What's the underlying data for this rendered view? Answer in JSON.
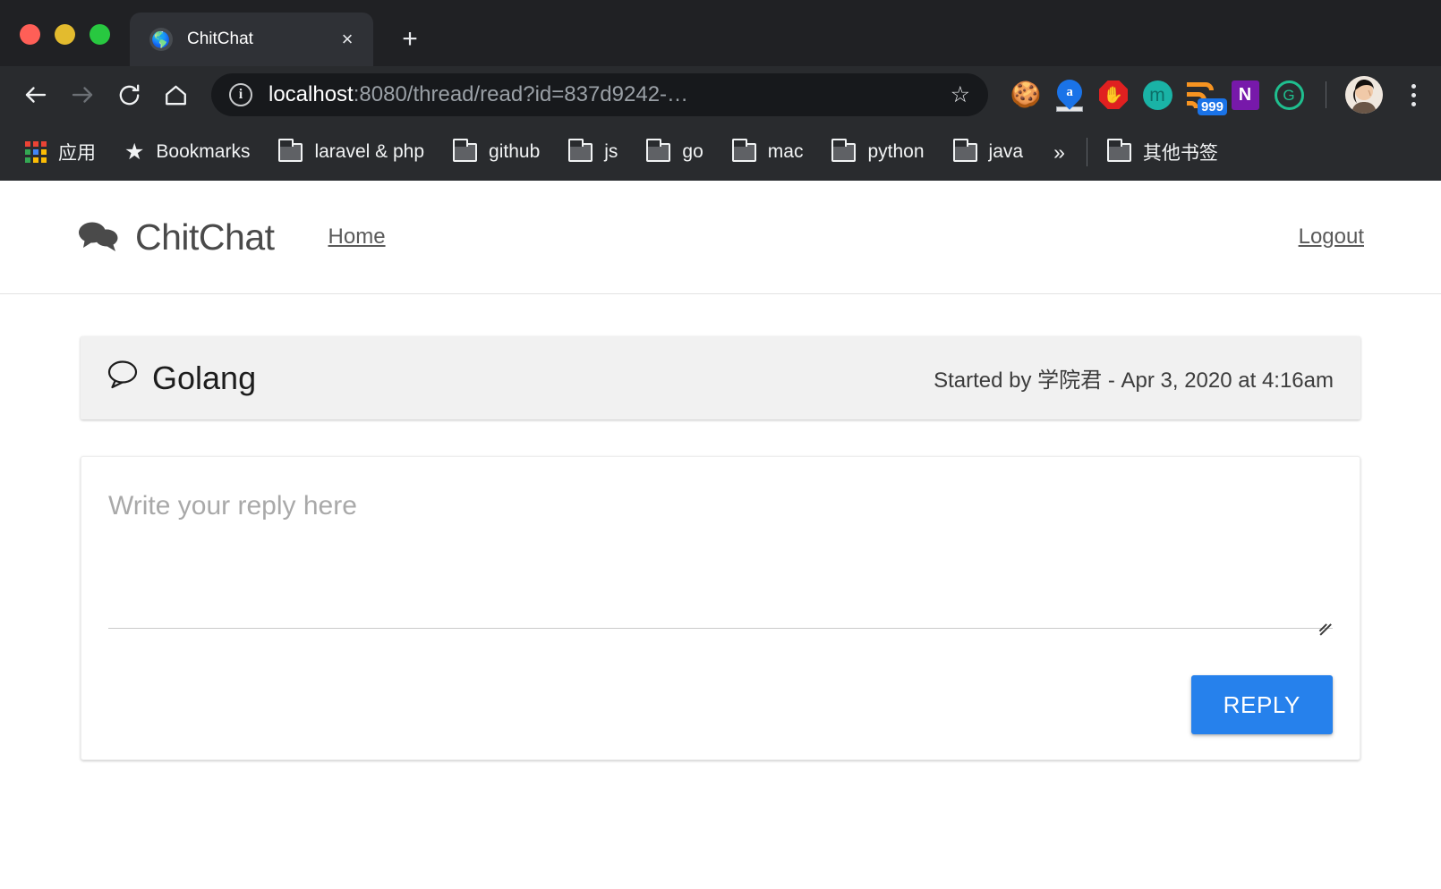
{
  "browser": {
    "window_controls": [
      "close",
      "minimize",
      "maximize"
    ],
    "tab": {
      "title": "ChitChat",
      "favicon": "globe-icon",
      "close_label": "×"
    },
    "new_tab_label": "+",
    "nav": {
      "back": "←",
      "forward": "→",
      "reload": "⟳",
      "home": "⌂"
    },
    "omnibox": {
      "info_icon": "i",
      "url_host": "localhost",
      "url_rest": ":8080/thread/read?id=837d9242-…",
      "bookmark_star": "☆"
    },
    "extensions": [
      {
        "name": "cookie-extension-icon",
        "glyph": "🍪"
      },
      {
        "name": "amazon-price-extension-icon",
        "glyph": "a"
      },
      {
        "name": "adblock-stop-extension-icon",
        "glyph": "✋"
      },
      {
        "name": "m-extension-icon",
        "glyph": "m"
      },
      {
        "name": "rss-feed-extension-icon",
        "badge": "999"
      },
      {
        "name": "onenote-extension-icon",
        "glyph": "N"
      },
      {
        "name": "grammarly-extension-icon",
        "glyph": "G"
      }
    ],
    "profile_avatar": "user-avatar",
    "menu_label": "⋮",
    "bookmarks": [
      {
        "name": "apps",
        "label": "应用",
        "icon": "apps-grid-icon"
      },
      {
        "name": "bookmarks",
        "label": "Bookmarks",
        "icon": "star-icon"
      },
      {
        "name": "laravel-php",
        "label": "laravel & php",
        "icon": "folder-icon"
      },
      {
        "name": "github",
        "label": "github",
        "icon": "folder-icon"
      },
      {
        "name": "js",
        "label": "js",
        "icon": "folder-icon"
      },
      {
        "name": "go",
        "label": "go",
        "icon": "folder-icon"
      },
      {
        "name": "mac",
        "label": "mac",
        "icon": "folder-icon"
      },
      {
        "name": "python",
        "label": "python",
        "icon": "folder-icon"
      },
      {
        "name": "java",
        "label": "java",
        "icon": "folder-icon"
      }
    ],
    "bookmarks_overflow": "»",
    "other_bookmarks": {
      "label": "其他书签",
      "icon": "folder-icon"
    }
  },
  "site": {
    "brand": {
      "name": "ChitChat",
      "icon": "chat-bubbles-icon"
    },
    "nav": {
      "home": "Home"
    },
    "logout": "Logout"
  },
  "thread": {
    "icon": "speech-bubble-icon",
    "title": "Golang",
    "meta": "Started by 学院君 - Apr 3, 2020 at 4:16am"
  },
  "reply": {
    "placeholder": "Write your reply here",
    "value": "",
    "button_label": "REPLY"
  },
  "colors": {
    "accent_blue": "#2681ec",
    "chrome_dark": "#292b2e",
    "tabstrip_dark": "#202124",
    "card_grey": "#f1f1f1"
  }
}
